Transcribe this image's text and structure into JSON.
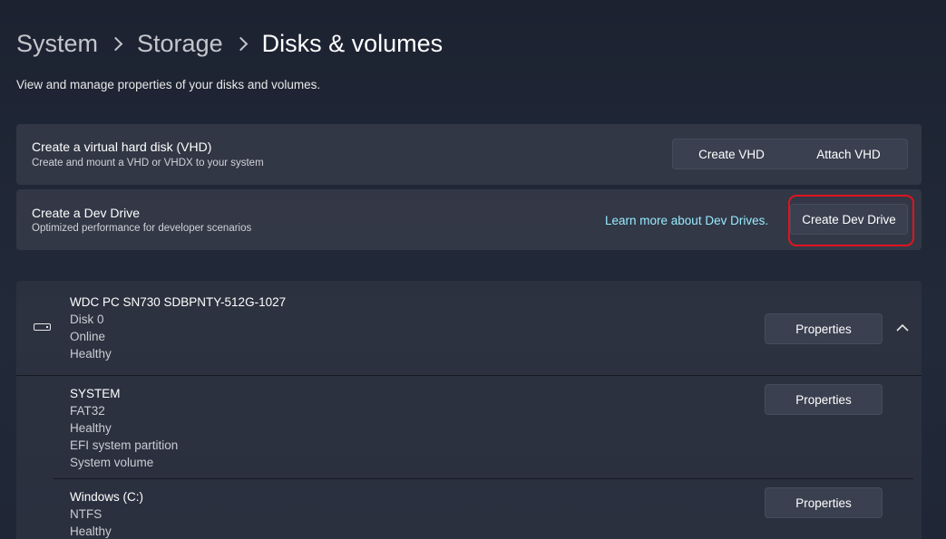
{
  "breadcrumb": {
    "items": [
      "System",
      "Storage",
      "Disks & volumes"
    ]
  },
  "subtitle": "View and manage properties of your disks and volumes.",
  "vhd_card": {
    "title": "Create a virtual hard disk (VHD)",
    "description": "Create and mount a VHD or VHDX to your system",
    "create_label": "Create VHD",
    "attach_label": "Attach VHD"
  },
  "dev_card": {
    "title": "Create a Dev Drive",
    "description": "Optimized performance for developer scenarios",
    "link_label": "Learn more about Dev Drives.",
    "create_label": "Create Dev Drive"
  },
  "disk": {
    "name": "WDC PC SN730 SDBPNTY-512G-1027",
    "lines": [
      "Disk 0",
      "Online",
      "Healthy"
    ],
    "properties_label": "Properties",
    "icon": "hard-drive-icon",
    "expanded": true
  },
  "volumes": [
    {
      "name": "SYSTEM",
      "lines": [
        "FAT32",
        "Healthy",
        "EFI system partition",
        "System volume"
      ],
      "properties_label": "Properties"
    },
    {
      "name": "Windows (C:)",
      "lines": [
        "NTFS",
        "Healthy"
      ],
      "properties_label": "Properties"
    }
  ],
  "colors": {
    "background": "#1f2533",
    "card": "#3a3f4c",
    "link": "#99ebff",
    "highlight": "#e0141f"
  }
}
